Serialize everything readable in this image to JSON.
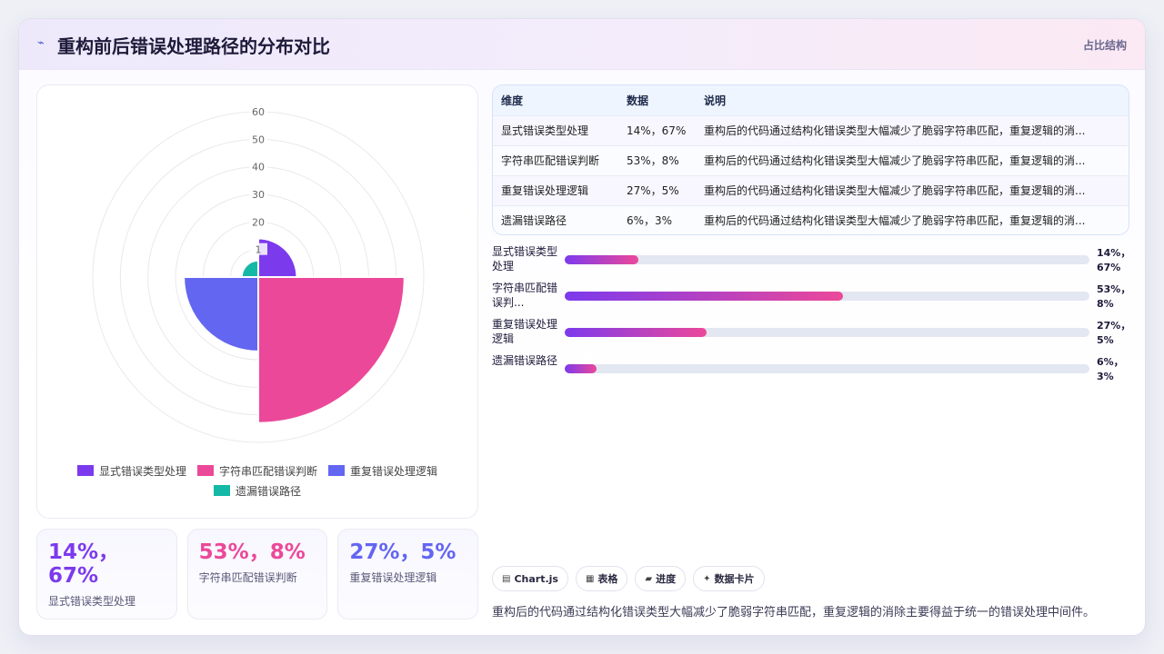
{
  "header": {
    "icon": "chart-line-icon",
    "title": "重构前后错误处理路径的分布对比",
    "tag": "占比结构"
  },
  "colors": {
    "purple": "#7c3aed",
    "pink": "#ec4899",
    "indigo": "#6366f1",
    "teal": "#14b8a6"
  },
  "chart_data": {
    "type": "polarArea",
    "categories": [
      "显式错误类型处理",
      "字符串匹配错误判断",
      "重复错误处理逻辑",
      "遗漏错误路径"
    ],
    "values": [
      14,
      53,
      27,
      6
    ],
    "colors": [
      "#7c3aed",
      "#ec4899",
      "#6366f1",
      "#14b8a6"
    ],
    "r_ticks": [
      "1",
      "20",
      "30",
      "40",
      "50",
      "60"
    ],
    "r_max": 60,
    "legend_position": "bottom"
  },
  "kpis": [
    {
      "value": "14%，67%",
      "label": "显式错误类型处理",
      "color": "#7c3aed"
    },
    {
      "value": "53%，8%",
      "label": "字符串匹配错误判断",
      "color": "#ec4899"
    },
    {
      "value": "27%，5%",
      "label": "重复错误处理逻辑",
      "color": "#6366f1"
    }
  ],
  "table": {
    "headers": [
      "维度",
      "数据",
      "说明"
    ],
    "rows": [
      [
        "显式错误类型处理",
        "14%，67%",
        "重构后的代码通过结构化错误类型大幅减少了脆弱字符串匹配，重复逻辑的消..."
      ],
      [
        "字符串匹配错误判断",
        "53%，8%",
        "重构后的代码通过结构化错误类型大幅减少了脆弱字符串匹配，重复逻辑的消..."
      ],
      [
        "重复错误处理逻辑",
        "27%，5%",
        "重构后的代码通过结构化错误类型大幅减少了脆弱字符串匹配，重复逻辑的消..."
      ],
      [
        "遗漏错误路径",
        "6%，3%",
        "重构后的代码通过结构化错误类型大幅减少了脆弱字符串匹配，重复逻辑的消..."
      ]
    ]
  },
  "progress": [
    {
      "label": "显式错误类型处理",
      "value": "14%，67%",
      "fraction": 0.14
    },
    {
      "label": "字符串匹配错误判...",
      "value": "53%，8%",
      "fraction": 0.53
    },
    {
      "label": "重复错误处理逻辑",
      "value": "27%，5%",
      "fraction": 0.27
    },
    {
      "label": "遗漏错误路径",
      "value": "6%，3%",
      "fraction": 0.06
    }
  ],
  "chips": [
    {
      "icon": "chart-icon",
      "glyph": "▤",
      "label": "Chart.js"
    },
    {
      "icon": "table-icon",
      "glyph": "▦",
      "label": "表格"
    },
    {
      "icon": "progress-icon",
      "glyph": "▰",
      "label": "进度"
    },
    {
      "icon": "card-icon",
      "glyph": "✦",
      "label": "数据卡片"
    }
  ],
  "note": "重构后的代码通过结构化错误类型大幅减少了脆弱字符串匹配，重复逻辑的消除主要得益于统一的错误处理中间件。"
}
